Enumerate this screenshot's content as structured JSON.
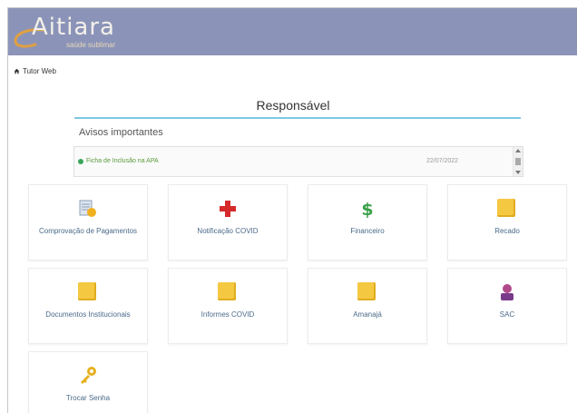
{
  "header": {
    "brand": "Aitiara",
    "brand_sub": "saúde sublimar",
    "bg": "#8b94b8"
  },
  "breadcrumb": {
    "label": "Tutor Web"
  },
  "page": {
    "title": "Responsável"
  },
  "notices": {
    "heading": "Avisos importantes",
    "items": [
      {
        "text": "Ficha de Inclusão na APA",
        "date": "22/07/2022"
      }
    ]
  },
  "tiles": [
    {
      "label": "Comprovação de Pagamentos",
      "icon": "receipt-icon"
    },
    {
      "label": "Notificação COVID",
      "icon": "red-cross-icon"
    },
    {
      "label": "Financeiro",
      "icon": "dollar-icon"
    },
    {
      "label": "Recado",
      "icon": "folder-icon"
    },
    {
      "label": "Documentos Institucionais",
      "icon": "folder-icon"
    },
    {
      "label": "Informes COVID",
      "icon": "folder-icon"
    },
    {
      "label": "Amanajá",
      "icon": "folder-icon"
    },
    {
      "label": "SAC",
      "icon": "person-icon"
    },
    {
      "label": "Trocar Senha",
      "icon": "key-icon"
    }
  ]
}
